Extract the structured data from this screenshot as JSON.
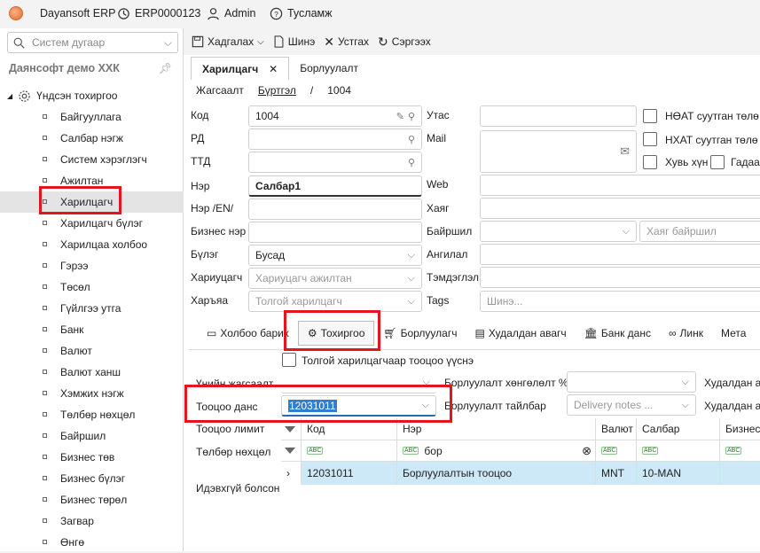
{
  "app": {
    "name": "Dayansoft ERP",
    "doc_code": "ERP0000123",
    "user": "Admin",
    "help": "Тусламж"
  },
  "sidebar": {
    "search_placeholder": "Систем дугаар",
    "company": "Даянсофт демо ХХК",
    "root": "Үндсэн тохиргоо",
    "items": [
      "Байгууллага",
      "Салбар нэгж",
      "Систем хэрэглэгч",
      "Ажилтан",
      "Харилцагч",
      "Харилцагч бүлэг",
      "Харилцаа холбоо",
      "Гэрээ",
      "Төсөл",
      "Гүйлгээ утга",
      "Банк",
      "Валют",
      "Валют ханш",
      "Хэмжих нэгж",
      "Төлбөр нөхцөл",
      "Байршил",
      "Бизнес төв",
      "Бизнес бүлэг",
      "Бизнес төрөл",
      "Загвар",
      "Өнгө"
    ],
    "selected": "Харилцагч"
  },
  "toolbar": {
    "save": "Хадгалах",
    "new": "Шинэ",
    "delete": "Устгах",
    "refresh": "Сэргээх"
  },
  "tabs": [
    "Харилцагч",
    "Борлуулалт"
  ],
  "breadcrumb": {
    "list": "Жагсаалт",
    "register": "Бүртгэл",
    "sep": "/",
    "id": "1004"
  },
  "form": {
    "code_label": "Код",
    "code_value": "1004",
    "rd_label": "РД",
    "ttd_label": "ТТД",
    "name_label": "Нэр",
    "name_value": "Салбар1",
    "name_en_label": "Нэр /EN/",
    "business_name_label": "Бизнес нэр",
    "group_label": "Бүлэг",
    "group_value": "Бусад",
    "responsible_label": "Хариуцагч",
    "responsible_placeholder": "Хариуцагч ажилтан",
    "belongs_label": "Харъяа",
    "belongs_placeholder": "Толгой харилцагч",
    "phone_label": "Утас",
    "mail_label": "Mail",
    "web_label": "Web",
    "address_label": "Хаяг",
    "location_label": "Байршил",
    "location_addr_placeholder": "Хаяг байршил",
    "description_label": "Ангилал",
    "note_label": "Тэмдэглэл",
    "tags_label": "Tags",
    "tags_placeholder": "Шинэ...",
    "vat_label": "НӨАТ суутган төлө",
    "nhat_label": "НХАТ суутган төлө",
    "individual_label": "Хувь хүн",
    "foreign_label": "Гадаа"
  },
  "subtabs": [
    "Холбоо барих",
    "Тохиргоо",
    "Борлуулагч",
    "Худалдан авагч",
    "Банк данс",
    "Линк",
    "Мета"
  ],
  "settings": {
    "head_checkbox": "Толгой харилцагчаар тооцоо үүснэ",
    "price_list_label": "Үнийн жагсаалт",
    "account_label": "Тооцоо данс",
    "account_value": "12031011",
    "limit_label": "Тооцоо лимит",
    "payment_label": "Төлбөр нөхцөл",
    "inactive_label": "Идэвхгүй болсон",
    "sales_discount_label": "Борлуулалт хөнгөлөлт %",
    "sales_note_label": "Борлуулалт тайлбар",
    "sales_note_placeholder": "Delivery notes ...",
    "purchase_label_1": "Худалдан ав",
    "purchase_label_2": "Худалдан ав"
  },
  "grid": {
    "columns": [
      "Код",
      "Нэр",
      "Валют",
      "Салбар",
      "Бизнес"
    ],
    "filter": {
      "name": "бор"
    },
    "rows": [
      {
        "code": "12031011",
        "name": "Борлуулалтын тооцоо",
        "currency": "MNT",
        "branch": "10-MAN",
        "business": ""
      }
    ]
  }
}
